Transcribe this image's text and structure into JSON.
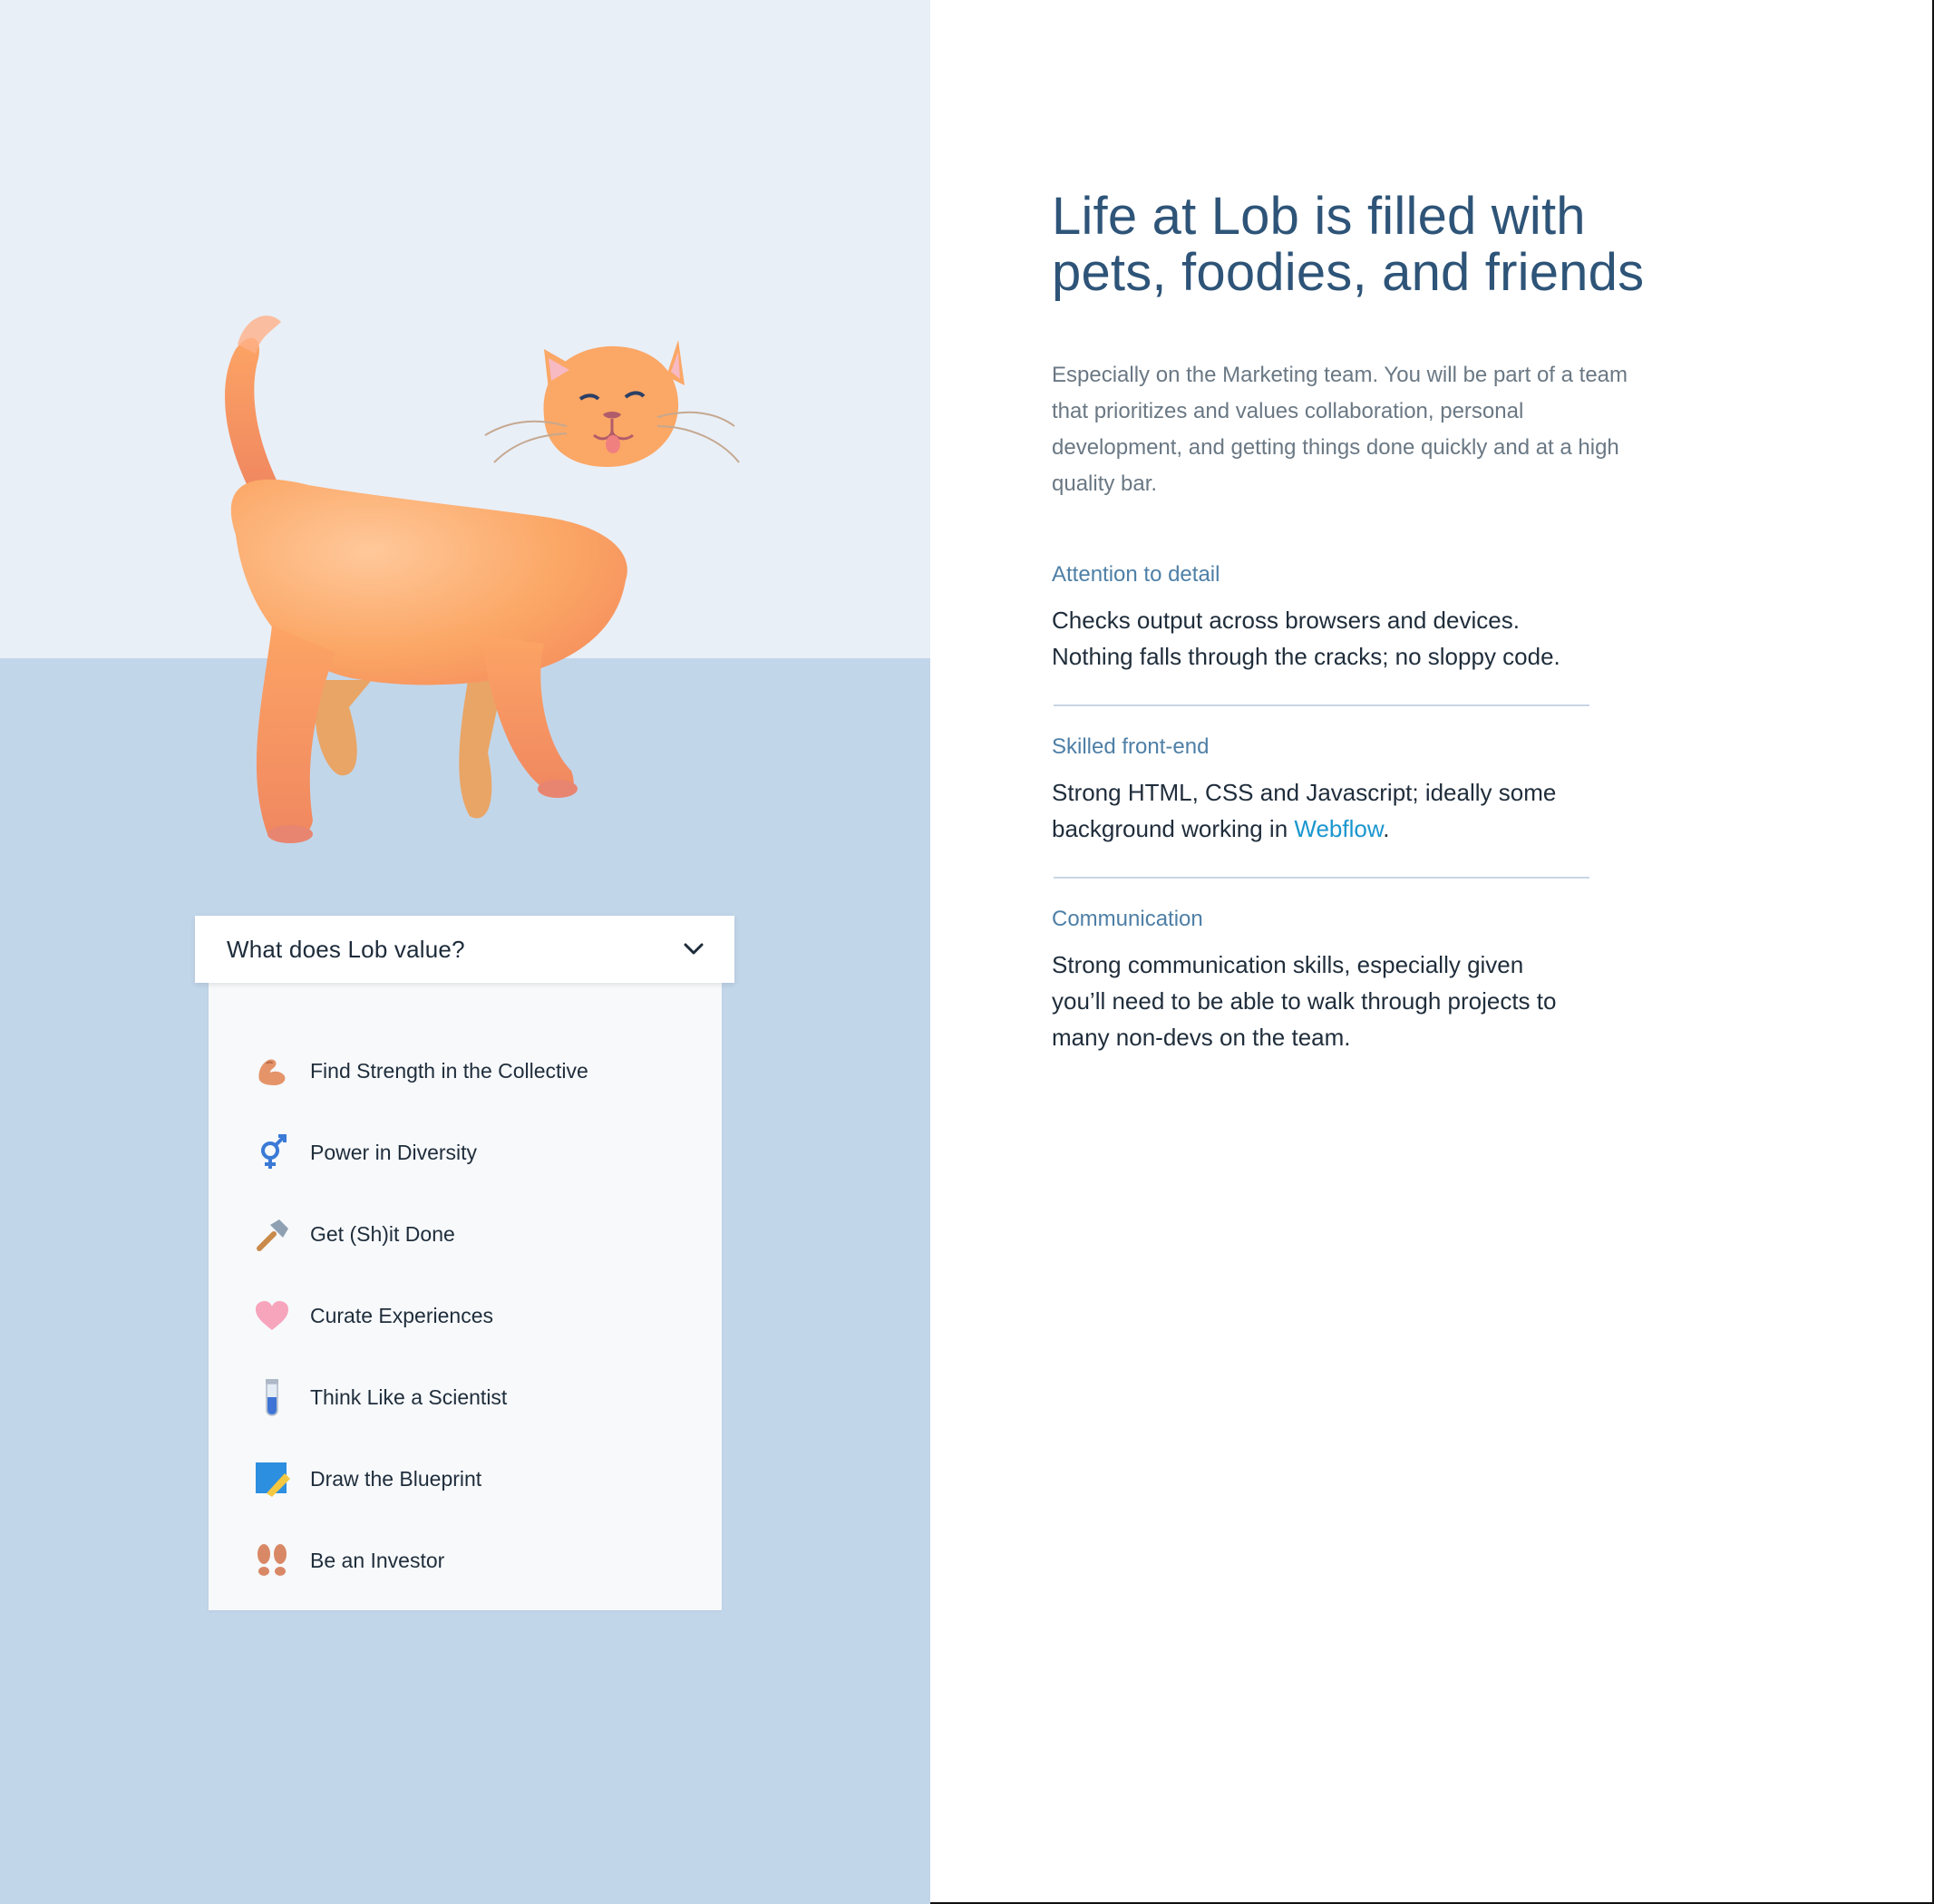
{
  "values_card": {
    "title": "What does Lob value?",
    "items": [
      {
        "icon": "flexed-biceps-icon",
        "label": "Find Strength in the Collective"
      },
      {
        "icon": "hermaphrodite-symbol-icon",
        "label": "Power in Diversity"
      },
      {
        "icon": "hammer-icon",
        "label": "Get (Sh)it Done"
      },
      {
        "icon": "heart-icon",
        "label": "Curate Experiences"
      },
      {
        "icon": "test-tube-icon",
        "label": "Think Like a Scientist"
      },
      {
        "icon": "memo-icon",
        "label": "Draw the Blueprint"
      },
      {
        "icon": "footprints-icon",
        "label": "Be an Investor"
      }
    ]
  },
  "content": {
    "headline": "Life at Lob is filled with pets, foodies, and friends",
    "intro": "Especially on the Marketing team. You will be part of a team that prioritizes and values collaboration, personal development, and getting things done quickly and at a high quality bar.",
    "qualities": [
      {
        "title": "Attention to detail",
        "description": "Checks output across browsers and devices. Nothing falls through the cracks; no sloppy code."
      },
      {
        "title": "Skilled front-end",
        "description_before": "Strong HTML, CSS and Javascript; ideally some background working in ",
        "link_text": "Webflow",
        "description_after": "."
      },
      {
        "title": "Communication",
        "description": "Strong communication skills, especially given you’ll need to be able to walk through projects to many non-devs on the team."
      }
    ]
  },
  "colors": {
    "left_top_bg": "#e9eff7",
    "left_bottom_bg": "#c2d6ea",
    "headline": "#2e5478",
    "quality_title": "#4e7fa6",
    "link": "#1a96cf",
    "cat_orange": "#f6a25e"
  }
}
